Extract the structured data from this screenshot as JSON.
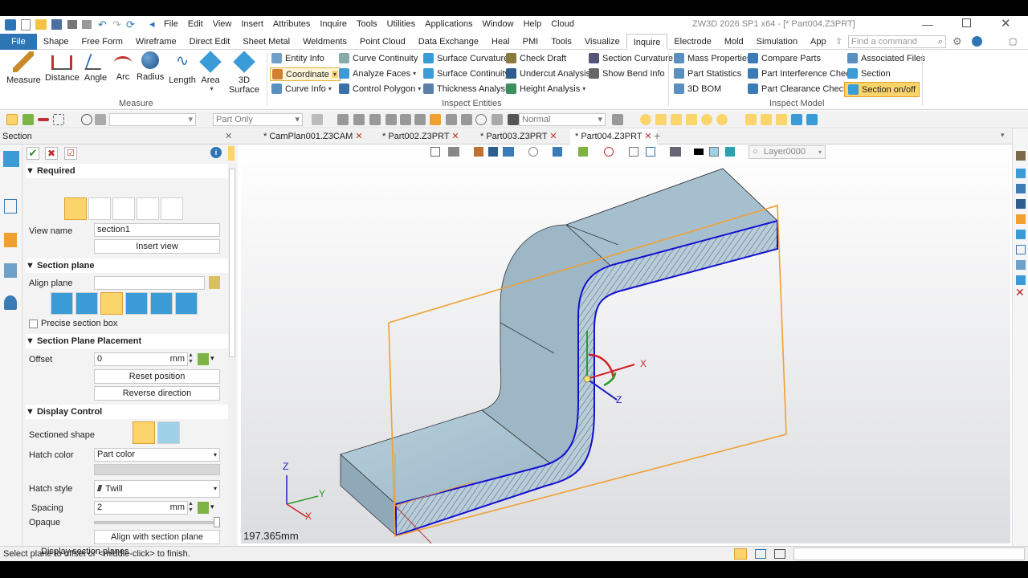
{
  "app": {
    "title": "ZW3D 2026 SP1 x64 - [* Part004.Z3PRT]"
  },
  "menu": [
    "File",
    "Edit",
    "View",
    "Insert",
    "Attributes",
    "Inquire",
    "Tools",
    "Utilities",
    "Applications",
    "Window",
    "Help",
    "Cloud"
  ],
  "ribbon_tabs": [
    "File",
    "Shape",
    "Free Form",
    "Wireframe",
    "Direct Edit",
    "Sheet Metal",
    "Weldments",
    "Point Cloud",
    "Data Exchange",
    "Heal",
    "PMI",
    "Tools",
    "Visualize",
    "Inquire",
    "Electrode",
    "Mold",
    "Simulation",
    "App"
  ],
  "active_ribbon_tab": "Inquire",
  "search": {
    "placeholder": "Find a command"
  },
  "ribbon": {
    "measure": {
      "label": "Measure",
      "buttons": [
        "Measure",
        "Distance",
        "Angle",
        "Arc",
        "Radius",
        "Length",
        "Area",
        "3D Surface"
      ]
    },
    "inspect": {
      "label": "Inspect Entities",
      "col1": [
        "Entity Info",
        "Coordinate",
        "Curve Info"
      ],
      "col2": [
        "Curve Continuity",
        "Analyze Faces",
        "Control Polygon"
      ],
      "col3": [
        "Surface Curvature",
        "Surface Continuity",
        "Thickness Analysis"
      ],
      "col4": [
        "Check Draft",
        "Undercut Analysis",
        "Height Analysis"
      ],
      "col5": [
        "Section Curvature",
        "Show Bend Info"
      ]
    },
    "model": {
      "label": "Inspect Model",
      "col1": [
        "Mass Properties",
        "Part Statistics",
        "3D BOM"
      ],
      "col2": [
        "Compare Parts",
        "Part Interference Check",
        "Part Clearance Check"
      ],
      "col3": [
        "Associated Files",
        "Section",
        "Section on/off"
      ]
    }
  },
  "toolbar2": {
    "filter": "Part Only",
    "render_mode": "Normal"
  },
  "panel_title": "Section",
  "doc_tabs": [
    "* CamPlan001.Z3CAM",
    "* Part002.Z3PRT",
    "* Part003.Z3PRT",
    "* Part004.Z3PRT"
  ],
  "active_doc": "* Part004.Z3PRT",
  "layer": "Layer0000",
  "section_panel": {
    "required": {
      "header": "Required",
      "view_name_label": "View name",
      "view_name": "section1",
      "insert_view": "Insert view"
    },
    "section_plane": {
      "header": "Section plane",
      "align_label": "Align plane",
      "precise_label": "Precise section box"
    },
    "placement": {
      "header": "Section Plane Placement",
      "offset_label": "Offset",
      "offset": "0",
      "unit": "mm",
      "reset": "Reset position",
      "reverse": "Reverse direction"
    },
    "display": {
      "header": "Display Control",
      "sectioned_shape_label": "Sectioned shape",
      "hatch_color_label": "Hatch color",
      "hatch_color": "Part color",
      "hatch_style_label": "Hatch style",
      "hatch_style": "Twill",
      "spacing_label": "Spacing",
      "spacing": "2",
      "unit": "mm",
      "opaque_label": "Opaque",
      "align_btn": "Align with section plane",
      "display_planes_label": "Display section planes"
    }
  },
  "viewport": {
    "dimension": "197.365mm",
    "axis_x": "X",
    "axis_y": "Y",
    "axis_z": "Z"
  },
  "status": {
    "prompt": "Select plane to offset or <middle-click> to finish."
  },
  "colors": {
    "accent": "#2e75b6",
    "highlight": "#fbd56b",
    "part": "#a9c3d2",
    "section_frame": "#f0a030",
    "section_edge": "#1010d0"
  }
}
